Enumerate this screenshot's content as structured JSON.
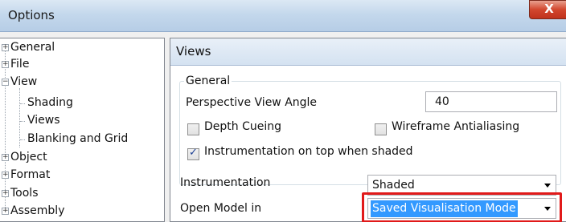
{
  "window": {
    "title": "Options",
    "close_label": "X"
  },
  "tree": {
    "items": [
      {
        "label": "General",
        "expander": "+"
      },
      {
        "label": "File",
        "expander": "+"
      },
      {
        "label": "View",
        "expander": "−"
      },
      {
        "label": "Shading"
      },
      {
        "label": "Views"
      },
      {
        "label": "Blanking and Grid"
      },
      {
        "label": "Object",
        "expander": "+"
      },
      {
        "label": "Format",
        "expander": "+"
      },
      {
        "label": "Tools",
        "expander": "+"
      },
      {
        "label": "Assembly",
        "expander": "+"
      }
    ]
  },
  "page": {
    "header": "Views",
    "group_label": "General",
    "perspective_label": "Perspective View Angle",
    "perspective_value": "40",
    "depth_cueing_label": "Depth Cueing",
    "depth_cueing_checked": false,
    "wireframe_label": "Wireframe Antialiasing",
    "wireframe_checked": false,
    "instrumentation_top_label": "Instrumentation on top when shaded",
    "instrumentation_top_checked": true,
    "instrumentation_label": "Instrumentation",
    "instrumentation_value": "Shaded",
    "open_model_label": "Open Model in",
    "open_model_value": "Saved Visualisation Mode"
  },
  "colors": {
    "selection": "#3399ff",
    "highlight": "#e11a1a"
  }
}
